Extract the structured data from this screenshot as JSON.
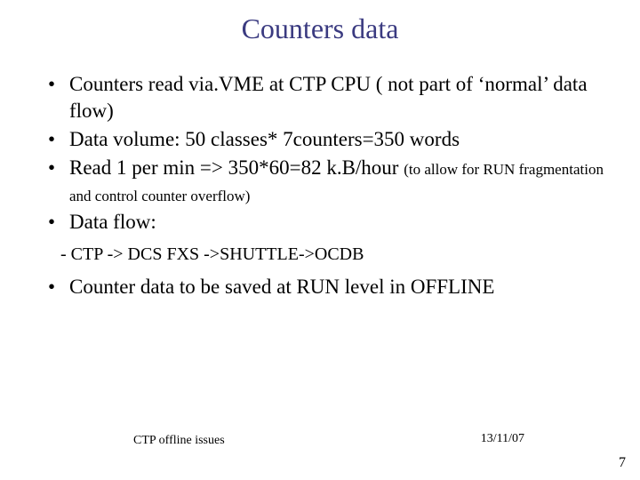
{
  "title": "Counters data",
  "bullets": {
    "b1": "Counters read via.VME at CTP CPU ( not part of ‘normal’ data flow)",
    "b2": "Data volume: 50 classes* 7counters=350 words",
    "b3_main": "Read 1 per min => 350*60=82 k.B/hour ",
    "b3_tail": "(to allow for RUN fragmentation and control counter overflow)",
    "b4": "Data flow:",
    "sub1": "- CTP -> DCS FXS ->SHUTTLE->OCDB",
    "b5": "Counter data to be saved at RUN level in OFFLINE"
  },
  "footer": {
    "left": "CTP offline issues",
    "right": "13/11/07",
    "page": "7"
  }
}
